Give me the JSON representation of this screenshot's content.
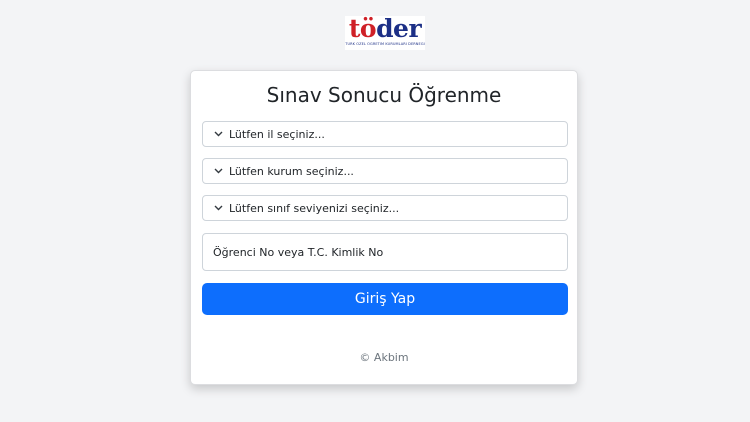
{
  "logo": {
    "word_accent": "tö",
    "word_rest": "der",
    "tagline": "TÜRK ÖZEL ÖĞRETİM KURUMLARI DERNEĞİ"
  },
  "card": {
    "title": "Sınav Sonucu Öğrenme",
    "province_select": {
      "value": "Lütfen il seçiniz...",
      "icon": "chevron-down-icon"
    },
    "institution_select": {
      "value": "Lütfen kurum seçiniz...",
      "icon": "chevron-down-icon"
    },
    "grade_select": {
      "value": "Lütfen sınıf seviyenizi seçiniz...",
      "icon": "chevron-down-icon"
    },
    "student_id_input": {
      "placeholder": "Öğrenci No veya T.C. Kimlik No"
    },
    "submit_label": "Giriş Yap",
    "footer": "© Akbim"
  },
  "colors": {
    "primary_button": "#0d6efd",
    "page_background": "#f3f4f6",
    "logo_red": "#cf2027",
    "logo_blue": "#1c2f86"
  }
}
